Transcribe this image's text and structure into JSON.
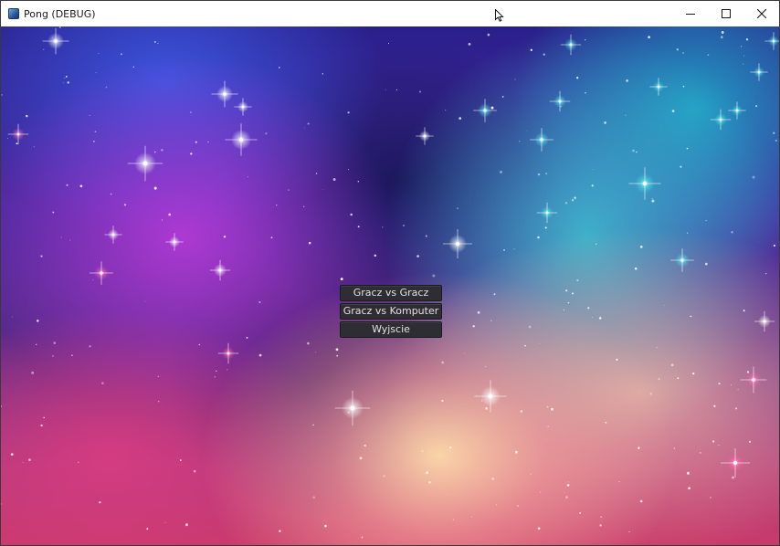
{
  "window": {
    "title": "Pong (DEBUG)",
    "icons": {
      "app": "app-icon",
      "minimize": "minimize-icon",
      "maximize": "maximize-icon",
      "close": "close-icon",
      "cursor": "mouse-cursor-icon"
    }
  },
  "menu": {
    "buttons": [
      {
        "label": "Gracz vs Gracz"
      },
      {
        "label": "Gracz vs Komputer"
      },
      {
        "label": "Wyjscie"
      }
    ]
  },
  "background": {
    "kind": "galaxy-nebula-starfield",
    "colors": [
      "#2a1f8a",
      "#be3cdc",
      "#3cc8d2",
      "#ffdcaa",
      "#dc3c82"
    ]
  }
}
